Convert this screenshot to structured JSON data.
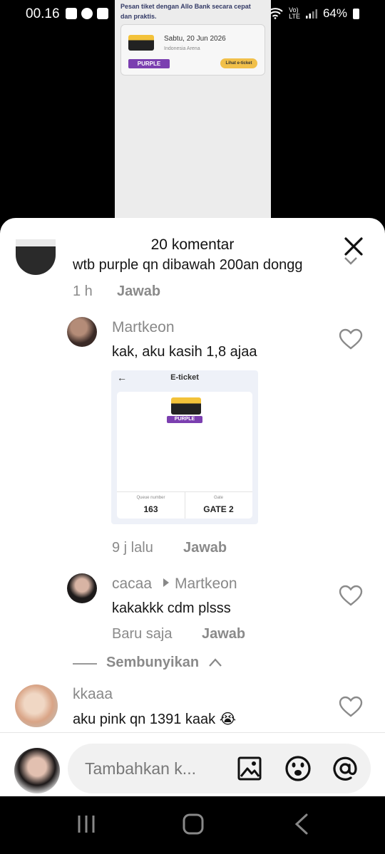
{
  "status_bar": {
    "time": "00.16",
    "network_top": "Vo)",
    "network_bottom": "LTE",
    "battery": "64%"
  },
  "video_preview": {
    "text": "Pesan tiket dengan Allo Bank secara cepat dan praktis.",
    "date": "Sabtu, 20 Jun 2026",
    "venue": "Indonesia Arena",
    "badge": "PURPLE",
    "button": "Lihat e-ticket"
  },
  "sheet": {
    "title": "20 komentar"
  },
  "comments": [
    {
      "text": "wtb purple qn dibawah 200an dongg",
      "time": "1 h",
      "reply_label": "Jawab"
    },
    {
      "username": "Martkeon",
      "text": "kak, aku kasih 1,8 ajaa",
      "time": "9 j lalu",
      "reply_label": "Jawab",
      "image": {
        "back": "←",
        "title": "E-ticket",
        "badge": "PURPLE",
        "queue_label": "Queue number",
        "queue_value": "163",
        "gate_label": "Gate",
        "gate_value": "GATE 2"
      }
    },
    {
      "username": "cacaa",
      "reply_to": "Martkeon",
      "text": "kakakkk cdm plsss",
      "time": "Baru saja",
      "reply_label": "Jawab"
    },
    {
      "username": "kkaaa",
      "text": "aku pink qn 1391 kaak 😭"
    }
  ],
  "hide_replies_label": "Sembunyikan",
  "input": {
    "placeholder": "Tambahkan k..."
  },
  "icons": [
    "close-icon",
    "heart-icon",
    "image-icon",
    "emoji-icon",
    "mention-icon",
    "recent-apps-icon",
    "home-icon",
    "back-icon"
  ],
  "colors": {
    "accent_purple": "#7b3fb0",
    "button_yellow": "#f1c04a",
    "sheet_bg": "#ffffff",
    "muted_text": "#8a8a8a"
  }
}
